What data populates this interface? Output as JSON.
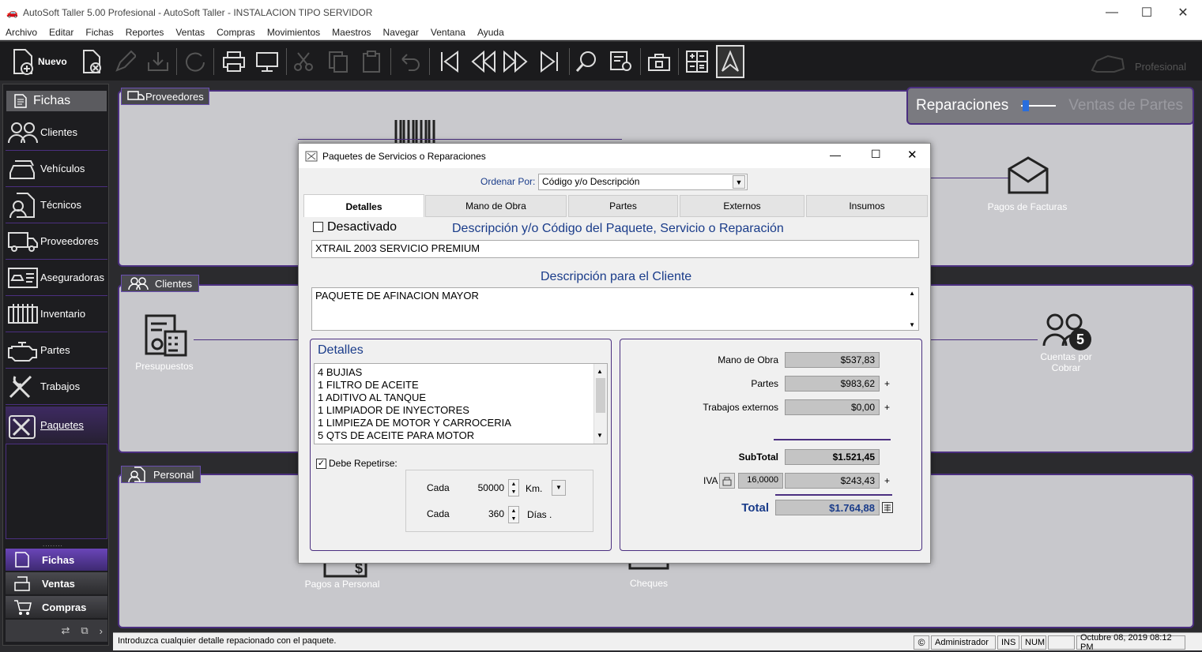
{
  "window": {
    "title": "AutoSoft Taller 5.00 Profesional - AutoSoft Taller - INSTALACION TIPO SERVIDOR",
    "min": "—",
    "max": "☐",
    "close": "✕"
  },
  "menu": [
    "Archivo",
    "Editar",
    "Fichas",
    "Reportes",
    "Ventas",
    "Compras",
    "Movimientos",
    "Maestros",
    "Navegar",
    "Ventana",
    "Ayuda"
  ],
  "toolbar": {
    "new_label": "Nuevo",
    "brand": "Profesional"
  },
  "sidebar": {
    "header": "Fichas",
    "items": [
      "Clientes",
      "Vehículos",
      "Técnicos",
      "Proveedores",
      "Aseguradoras",
      "Inventario",
      "Partes",
      "Trabajos",
      "Paquetes"
    ],
    "bottom": [
      "Fichas",
      "Ventas",
      "Compras"
    ]
  },
  "workarea": {
    "mode_left": "Reparaciones",
    "mode_right": "Ventas de Partes",
    "panels": {
      "proveedores": "Proveedores",
      "clientes": "Clientes",
      "personal": "Personal"
    },
    "icons": {
      "pagos_facturas": "Pagos de Facturas",
      "presupuestos": "Presupuestos",
      "cuentas_cobrar": "Cuentas por Cobrar",
      "pagos_personal": "Pagos a Personal",
      "cheques": "Cheques"
    }
  },
  "dialog": {
    "title": "Paquetes de Servicios o Reparaciones",
    "order_label": "Ordenar Por:",
    "order_value": "Código y/o Descripción",
    "tabs": [
      "Detalles",
      "Mano de Obra",
      "Partes",
      "Externos",
      "Insumos"
    ],
    "desactivado": "Desactivado",
    "desc_heading": "Descripción y/o Código del Paquete, Servicio o Reparación",
    "desc_value": "XTRAIL 2003  SERVICIO PREMIUM",
    "client_heading": "Descripción para el Cliente",
    "client_value": "PAQUETE DE AFINACION MAYOR",
    "details_heading": "Detalles",
    "details_lines": [
      "4 BUJIAS",
      "1 FILTRO DE ACEITE",
      "1 ADITIVO AL TANQUE",
      "1 LIMPIADOR DE INYECTORES",
      "1 LIMPIEZA DE MOTOR Y CARROCERIA",
      "5 QTS DE ACEITE PARA MOTOR"
    ],
    "repeat_label": "Debe Repetirse:",
    "cada1": "Cada",
    "km_value": "50000",
    "km_unit": "Km.",
    "cada2": "Cada",
    "days_value": "360",
    "days_unit": "Días .",
    "totals": {
      "mano_label": "Mano de Obra",
      "mano_value": "$537,83",
      "partes_label": "Partes",
      "partes_value": "$983,62",
      "externos_label": "Trabajos externos",
      "externos_value": "$0,00",
      "subtotal_label": "SubTotal",
      "subtotal_value": "$1.521,45",
      "iva_label": "IVA",
      "iva_rate": "16,0000",
      "iva_value": "$243,43",
      "total_label": "Total",
      "total_value": "$1.764,88",
      "plus": "+"
    }
  },
  "status": {
    "message": "Introduzca cualquier detalle repacionado con el paquete.",
    "user": "Administrador",
    "ins": "INS",
    "num": "NUM",
    "datetime": "Octubre 08, 2019 08:12 PM"
  },
  "colors": {
    "accent": "#4b2f80",
    "blue_text": "#1a3c8a"
  }
}
